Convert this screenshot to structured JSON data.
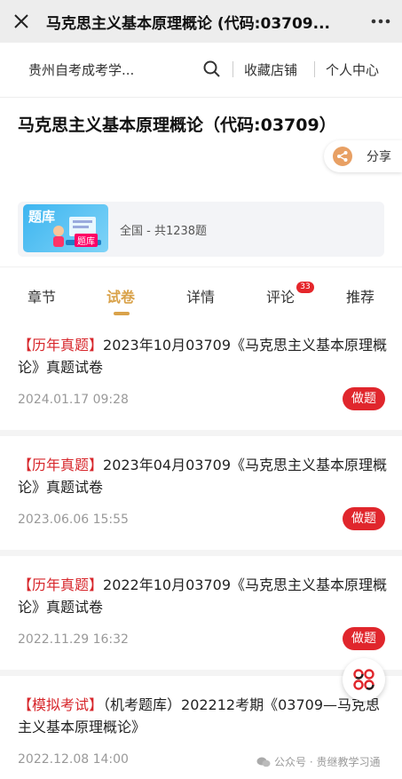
{
  "window": {
    "title": "马克思主义基本原理概论 (代码:03709...",
    "close_icon": "close-icon",
    "more_icon": "more-icon"
  },
  "shopbar": {
    "shop_name": "贵州自考成考学...",
    "search_icon": "search-icon",
    "favorite": "收藏店铺",
    "personal": "个人中心"
  },
  "product": {
    "name": "马克思主义基本原理概论（代码:03709）",
    "share_label": "分享",
    "thumb_title": "题库",
    "thumb_badge": "题库",
    "meta": "全国 - 共1238题"
  },
  "tabs": [
    {
      "label": "章节"
    },
    {
      "label": "试卷"
    },
    {
      "label": "详情"
    },
    {
      "label": "评论",
      "badge": "33"
    },
    {
      "label": "推荐"
    }
  ],
  "active_tab": "试卷",
  "papers": [
    {
      "tag": "【历年真题】",
      "title": "2023年10月03709《马克思主义基本原理概论》真题试卷",
      "date": "2024.01.17 09:28",
      "button": "做题"
    },
    {
      "tag": "【历年真题】",
      "title": "2023年04月03709《马克思主义基本原理概论》真题试卷",
      "date": "2023.06.06 15:55",
      "button": "做题"
    },
    {
      "tag": "【历年真题】",
      "title": "2022年10月03709《马克思主义基本原理概论》真题试卷",
      "date": "2022.11.29 16:32",
      "button": "做题"
    },
    {
      "tag": "【模拟考试】",
      "title": "（机考题库）202212考期《03709—马克思主义基本原理概论》",
      "date": "2022.12.08 14:00",
      "button": ""
    }
  ],
  "watermark": "公众号 · 贵继教学习通",
  "colors": {
    "accent": "#d9a24a",
    "red": "#e0262c"
  }
}
